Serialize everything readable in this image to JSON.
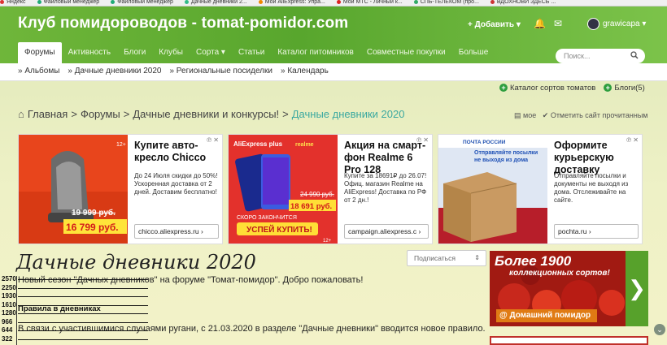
{
  "bookmarks": [
    "Яндекс",
    "Файловый менеджер",
    "Файловый менеджер",
    "Дачные дневники 2...",
    "Мой AliExpress: Упра...",
    "Мой МТС - Личный к...",
    "СПБ-ТЕЛЕКОМ (про...",
    "ВДОХНОВИ ЗДЕСЬ ..."
  ],
  "header": {
    "site_title": "Клуб помидороводов - tomat-pomidor.com",
    "add_label": "+ Добавить ▾",
    "bell_icon": "🔔",
    "mail_icon": "✉",
    "username": "grawicapa ▾"
  },
  "nav": {
    "items": [
      "Форумы",
      "Активность",
      "Блоги",
      "Клубы",
      "Сорта ▾",
      "Статьи",
      "Каталог питомников",
      "Совместные покупки",
      "Больше"
    ],
    "search_placeholder": "Поиск..."
  },
  "subnav": [
    "» Альбомы",
    "» Дачные дневники 2020",
    "» Региональные посиделки",
    "» Календарь"
  ],
  "catalog_links": [
    "Каталог сортов томатов",
    "Блоги(5)"
  ],
  "breadcrumb": {
    "home": "Главная",
    "items": [
      "Форумы",
      "Дачные дневники и конкурсы!"
    ],
    "current": "Дачные дневники 2020",
    "sep": ">"
  },
  "actions": {
    "mine": "мое",
    "mark_read": "Отметить сайт прочитанным"
  },
  "ads": [
    {
      "title": "Купите авто-кресло Chicco",
      "text": "До 24 Июля скидки до 50%! Ускоренная доставка от 2 дней. Доставим бесплатно!",
      "url": "chicco.aliexpress.ru",
      "old_price": "19 999 руб.",
      "new_price": "16 799 руб.",
      "badge": "12+"
    },
    {
      "title": "Акция на смарт-фон Realme 6 Pro 128",
      "text": "Купите за 18691₽ до 26.07! Офиц. магазин Realme на AliExpress! Доставка по РФ от 2 дн.!",
      "url": "campaign.aliexpress.c",
      "brand": "AliExpress plus",
      "brand2": "realme",
      "old_price": "24 990 руб.",
      "new_price": "18 691 руб.",
      "promo": "СКОРО ЗАКОНЧИТСЯ",
      "cta": "УСПЕЙ КУПИТЬ!",
      "badge": "12+"
    },
    {
      "title": "Оформите курьерскую доставку",
      "text": "Отправляйте посылки и документы не выходя из дома. Отслеживайте на сайте.",
      "url": "pochta.ru",
      "brand": "ПОЧТА РОССИИ",
      "slogan": "Отправляйте посылки не выходя из дома",
      "badge": "0+"
    }
  ],
  "page": {
    "title": "Дачные дневники 2020",
    "sort_label": "Подписаться",
    "intro": "Новый сезон \"Дачных дневников\" на форуме \"Томат-помидор\". Добро пожаловать!",
    "rules_title": "Правила в дневниках",
    "rules_text": "В связи с участившимися случаями ругани, с 21.03.2020 в разделе \"Дачные дневники\" вводится новое правило."
  },
  "overlay_numbers": [
    "2570",
    "2250",
    "1930",
    "1610",
    "1280",
    "966",
    "644",
    "322"
  ],
  "side_banner": {
    "title": "Более 1900",
    "subtitle": "коллекционных сортов!",
    "button": "@ Домашний помидор",
    "arrow": "❯"
  },
  "ad_flag": "℗ ✕",
  "scroll_icon": "⌄"
}
